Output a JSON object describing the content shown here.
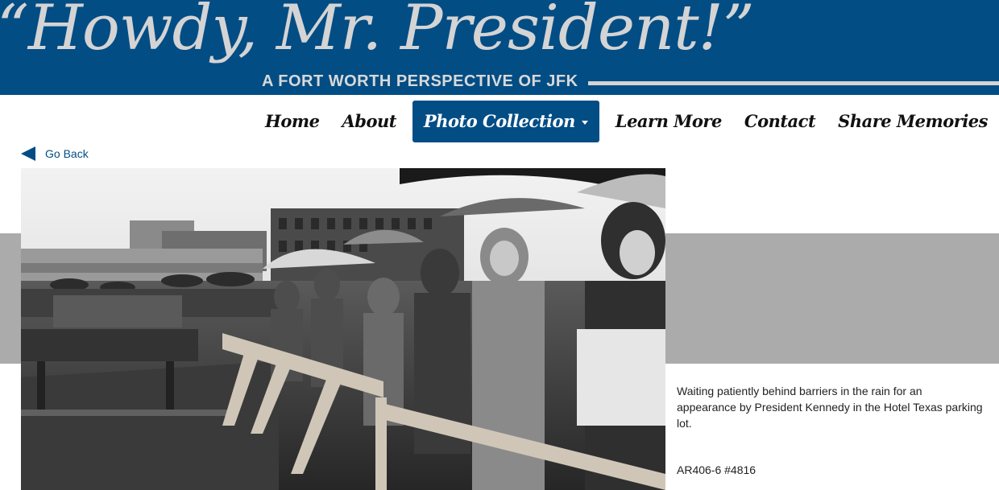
{
  "header": {
    "title": "“Howdy, Mr. President!”",
    "subtitle": "A FORT WORTH PERSPECTIVE OF JFK"
  },
  "nav": {
    "items": [
      {
        "label": "Home"
      },
      {
        "label": "About"
      },
      {
        "label": "Photo Collection",
        "active": true
      },
      {
        "label": "Learn More"
      },
      {
        "label": "Contact"
      },
      {
        "label": "Share Memories"
      }
    ]
  },
  "goback": {
    "label": "Go Back",
    "icon": "back-arrow-icon"
  },
  "photo": {
    "caption": "Waiting patiently behind barriers in the rain for an appearance by President Kennedy in the Hotel Texas parking lot.",
    "reference": "AR406-6 #4816"
  },
  "colors": {
    "brand": "#034d85",
    "band": "#ababab",
    "banner_text": "#d4d4d4"
  }
}
